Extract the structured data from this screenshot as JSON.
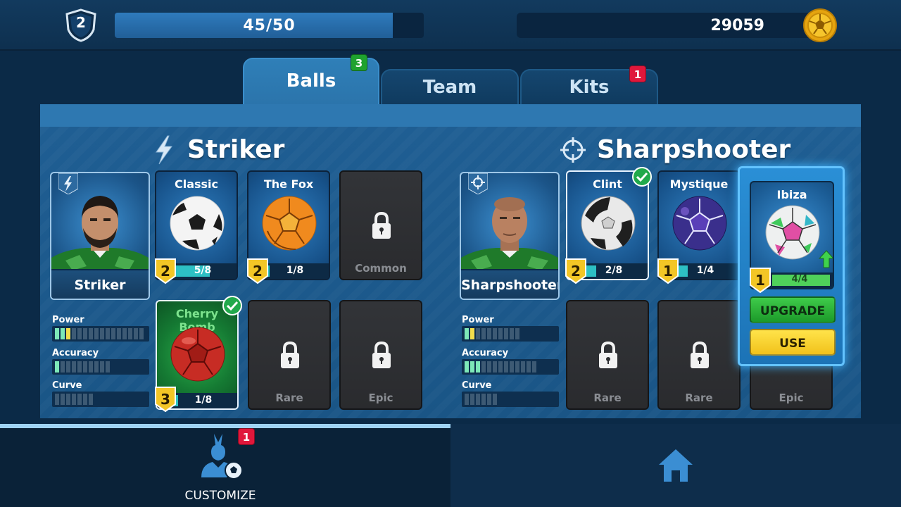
{
  "header": {
    "player_level": "2",
    "xp_text": "45/50",
    "xp_fraction": 0.9,
    "coins": "29059"
  },
  "tabs": [
    {
      "label": "Balls",
      "badge": "3",
      "active": true
    },
    {
      "label": "Team",
      "badge": "",
      "active": false
    },
    {
      "label": "Kits",
      "badge": "1",
      "active": false
    }
  ],
  "striker": {
    "title": "Striker",
    "player_name": "Striker",
    "balls": [
      {
        "name": "Classic",
        "level": "2",
        "progress": "5/8",
        "fill": 0.625
      },
      {
        "name": "The Fox",
        "level": "2",
        "progress": "1/8",
        "fill": 0.125
      },
      {
        "locked_label": "Common"
      },
      {
        "name": "Cherry Bomb",
        "level": "3",
        "progress": "1/8",
        "fill": 0.125,
        "equipped": true
      },
      {
        "locked_label": "Rare"
      },
      {
        "locked_label": "Epic"
      }
    ],
    "stats": [
      {
        "label": "Power",
        "green": 2,
        "yellow": 1,
        "total": 16
      },
      {
        "label": "Accuracy",
        "green": 1,
        "yellow": 0,
        "total": 10
      },
      {
        "label": "Curve",
        "green": 0,
        "yellow": 0,
        "total": 7
      }
    ]
  },
  "sharpshooter": {
    "title": "Sharpshooter",
    "player_name": "Sharpshooter",
    "balls": [
      {
        "name": "Clint",
        "level": "2",
        "progress": "2/8",
        "fill": 0.25,
        "equipped": true
      },
      {
        "name": "Mystique",
        "level": "1",
        "progress": "1/4",
        "fill": 0.25
      },
      {
        "locked_label": "Rare"
      },
      {
        "locked_label": "Rare"
      },
      {
        "locked_label": "Epic"
      }
    ],
    "stats": [
      {
        "label": "Power",
        "green": 1,
        "yellow": 1,
        "total": 10
      },
      {
        "label": "Accuracy",
        "green": 3,
        "yellow": 0,
        "total": 13
      },
      {
        "label": "Curve",
        "green": 0,
        "yellow": 0,
        "total": 6
      }
    ]
  },
  "popup": {
    "ball_name": "Ibiza",
    "level": "1",
    "progress": "4/4",
    "upgrade_label": "UPGRADE",
    "use_label": "USE"
  },
  "bottom_nav": {
    "customize_label": "CUSTOMIZE",
    "customize_badge": "1"
  },
  "colors": {
    "accent_blue": "#2e78b1",
    "level_gold": "#f3c626",
    "upgrade_green": "#3fcb4a",
    "use_yellow": "#ffe34a",
    "badge_red": "#e0173b",
    "badge_green": "#1fa22f"
  }
}
